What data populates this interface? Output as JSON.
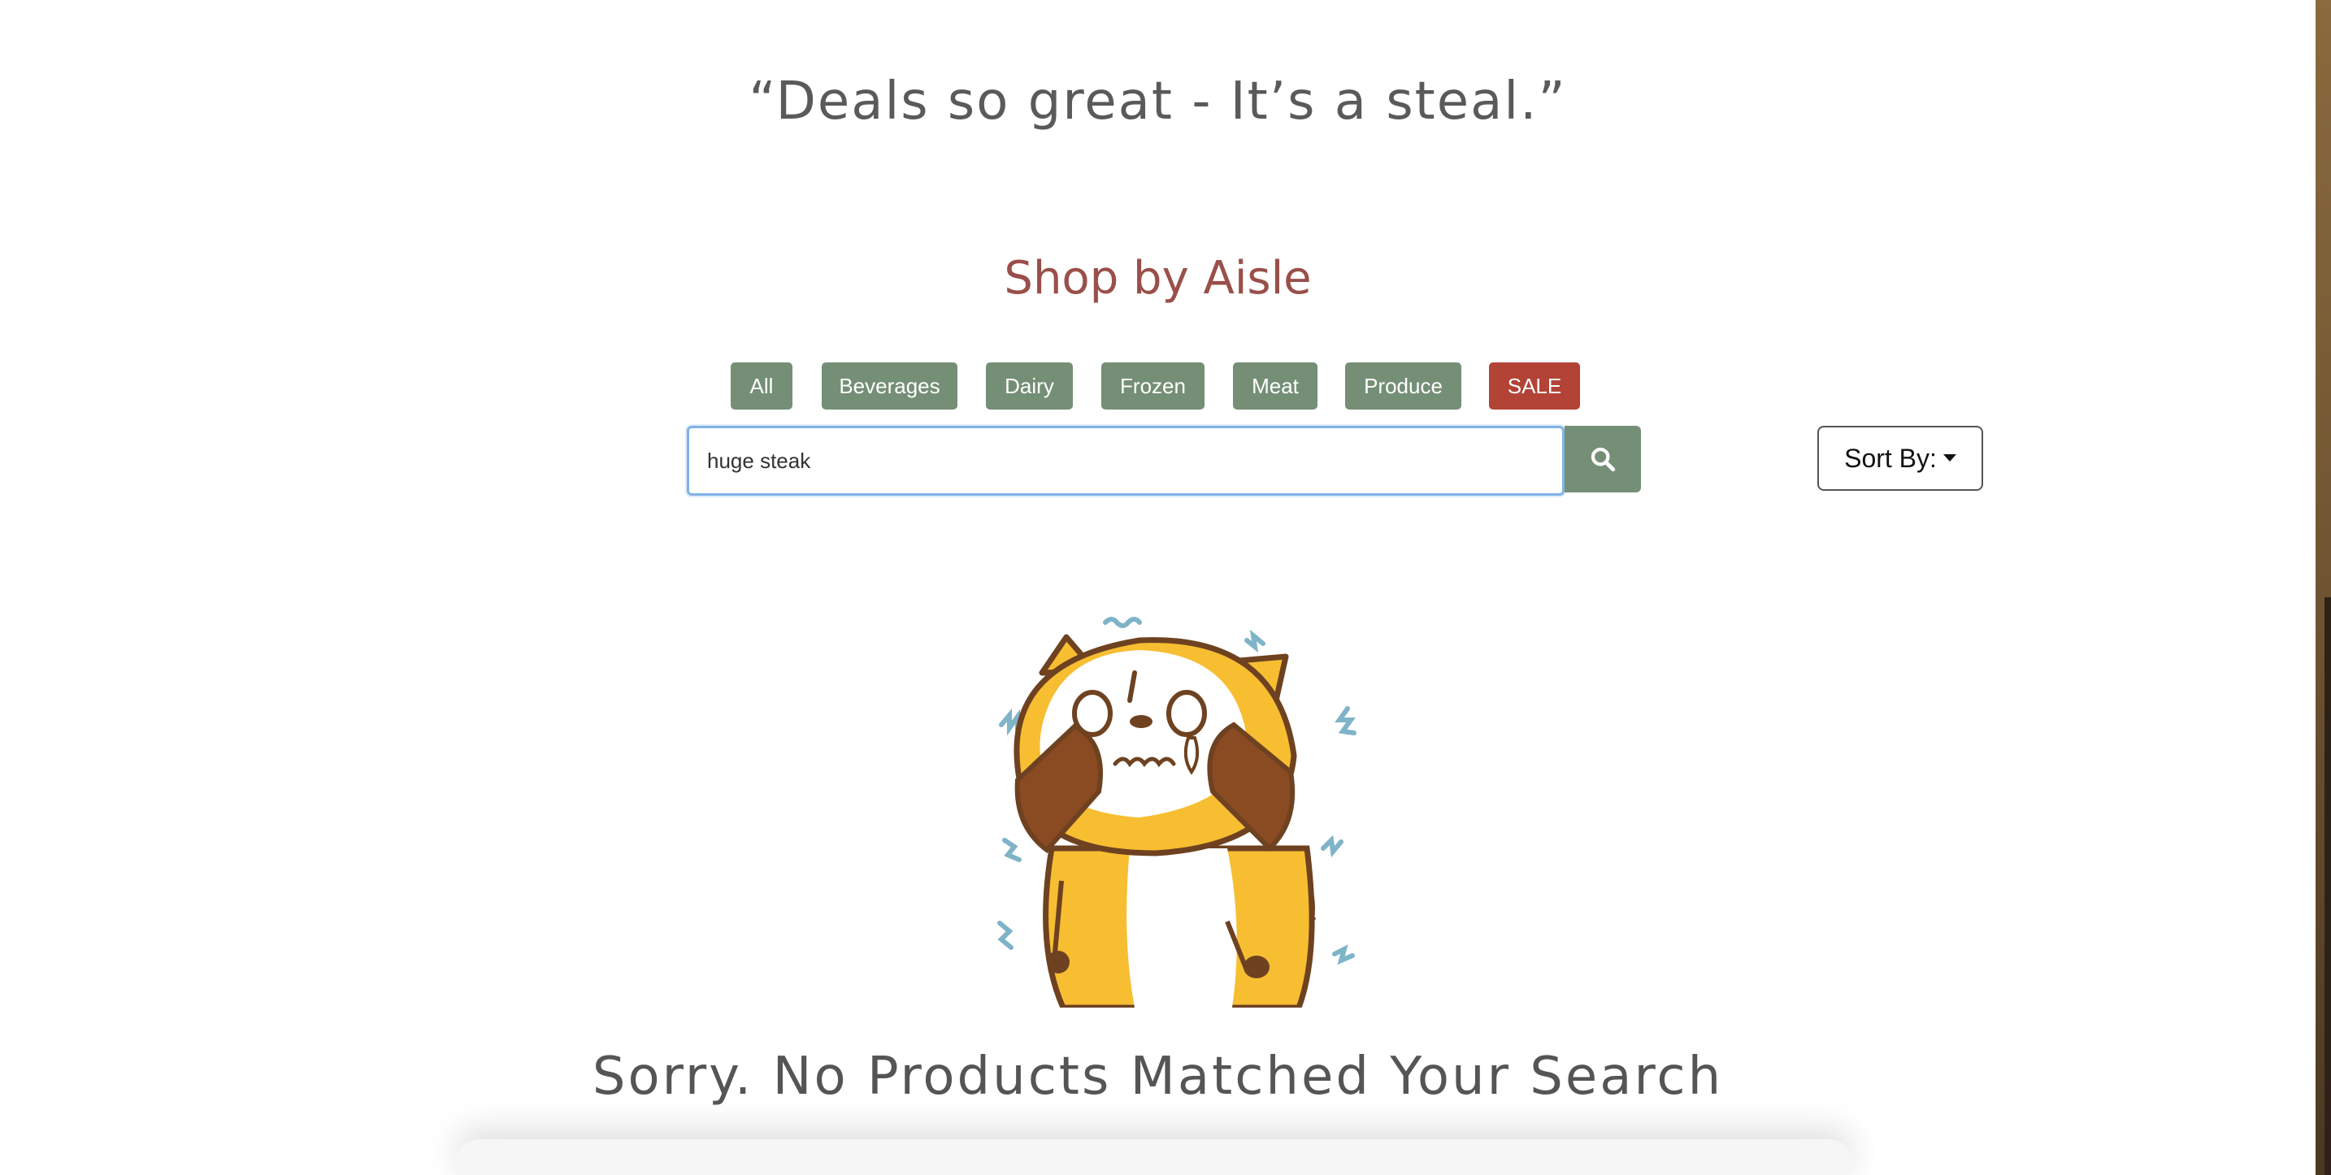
{
  "tagline": "“Deals so great - It’s a steal.”",
  "aisle_section": {
    "heading": "Shop by Aisle",
    "buttons": [
      "All",
      "Beverages",
      "Dairy",
      "Frozen",
      "Meat",
      "Produce",
      "SALE"
    ]
  },
  "search": {
    "value": "huge steak",
    "button_icon": "search-icon"
  },
  "sort": {
    "label": "Sort By:"
  },
  "empty_state": {
    "illustration": "scared-raccoon",
    "message": "Sorry. No Products Matched Your Search"
  },
  "colors": {
    "aisle_button": "#748f76",
    "sale_button": "#b24336",
    "heading": "#9a4f4a",
    "text": "#555555"
  }
}
